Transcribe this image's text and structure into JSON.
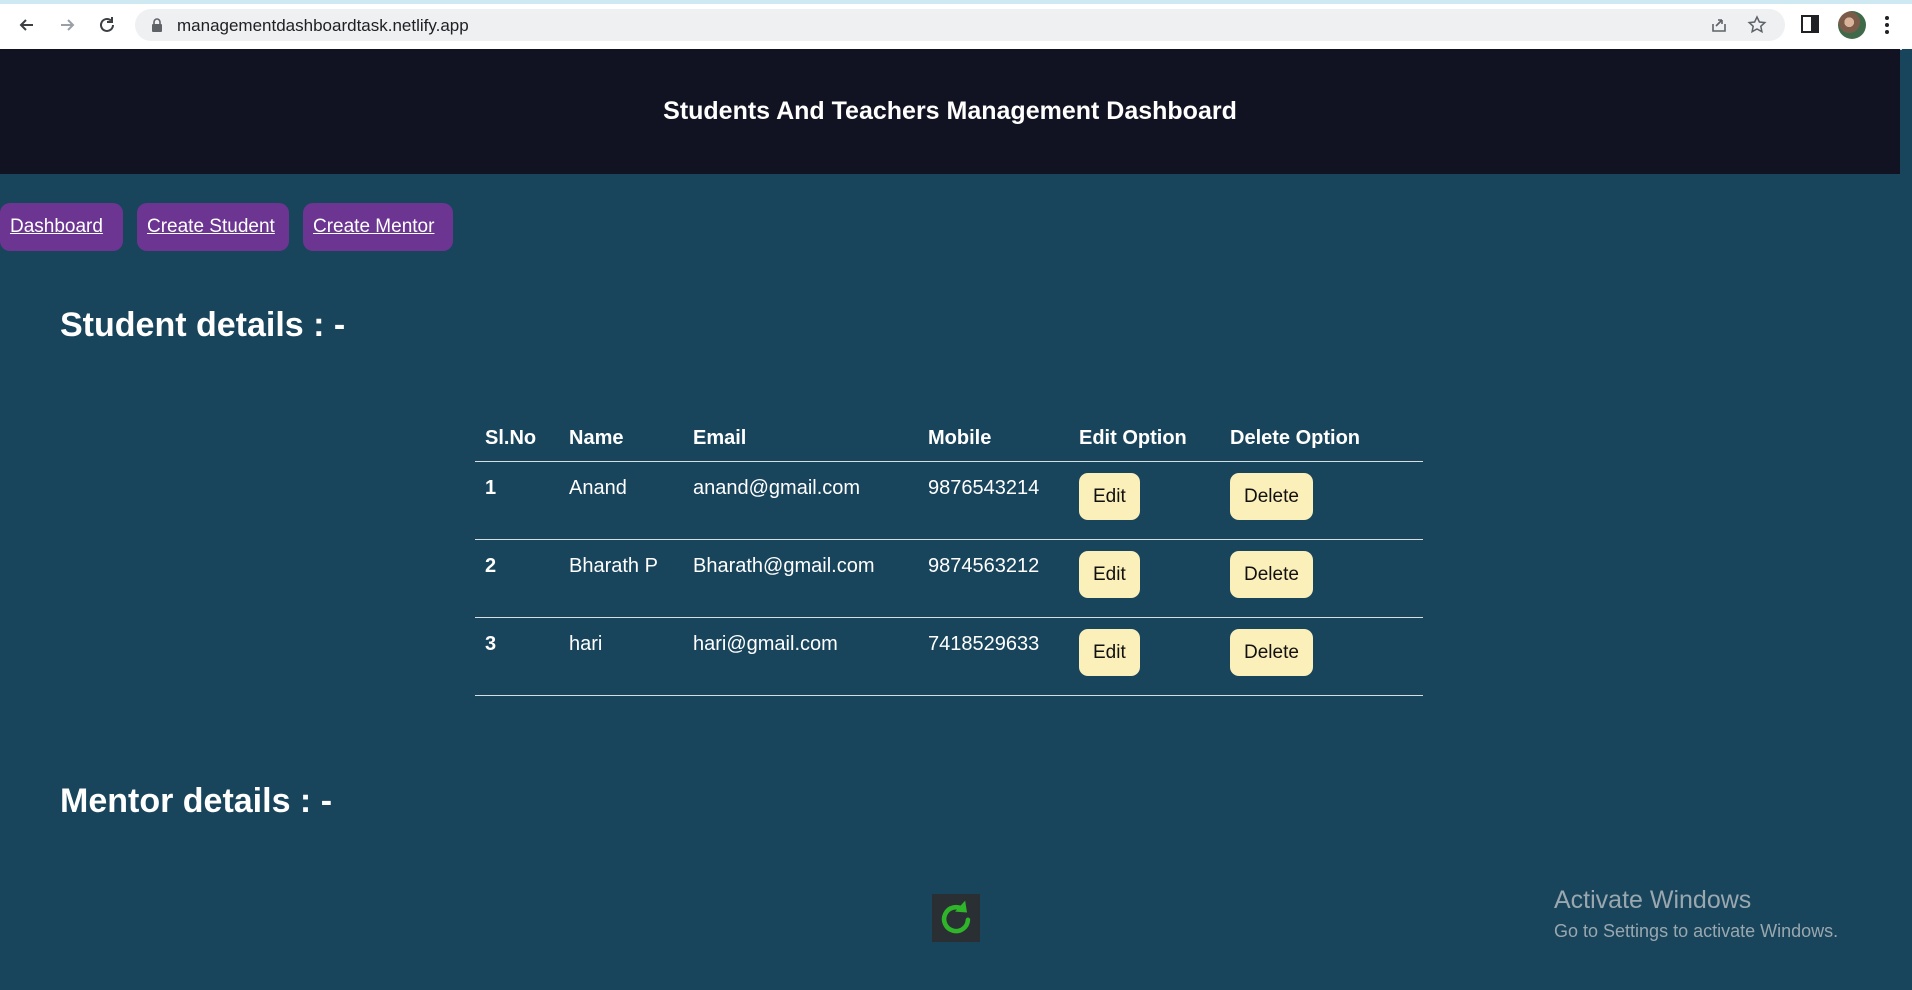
{
  "browser": {
    "url": "managementdashboardtask.netlify.app"
  },
  "header": {
    "title": "Students And Teachers Management Dashboard"
  },
  "nav": {
    "items": [
      {
        "label": "Dashboard"
      },
      {
        "label": "Create Student"
      },
      {
        "label": "Create Mentor"
      }
    ]
  },
  "students": {
    "heading": "Student details : -",
    "columns": [
      "Sl.No",
      "Name",
      "Email",
      "Mobile",
      "Edit Option",
      "Delete Option"
    ],
    "rows": [
      {
        "sl": "1",
        "name": "Anand",
        "email": "anand@gmail.com",
        "mobile": "9876543214",
        "edit": "Edit",
        "delete": "Delete"
      },
      {
        "sl": "2",
        "name": "Bharath P",
        "email": "Bharath@gmail.com",
        "mobile": "9874563212",
        "edit": "Edit",
        "delete": "Delete"
      },
      {
        "sl": "3",
        "name": "hari",
        "email": "hari@gmail.com",
        "mobile": "7418529633",
        "edit": "Edit",
        "delete": "Delete"
      }
    ]
  },
  "mentors": {
    "heading": "Mentor details : -"
  },
  "watermark": {
    "line1": "Activate Windows",
    "line2": "Go to Settings to activate Windows."
  },
  "colors": {
    "page_bg": "#18455c",
    "header_bg": "#111222",
    "nav_button": "#6c3591",
    "action_button": "#fbf0b9",
    "loader_icon": "#2fb52a"
  },
  "icons": [
    "back-arrow-icon",
    "forward-arrow-icon",
    "reload-icon",
    "lock-icon",
    "share-icon",
    "star-icon",
    "side-panel-icon",
    "kebab-menu-icon",
    "refresh-loader-icon"
  ]
}
